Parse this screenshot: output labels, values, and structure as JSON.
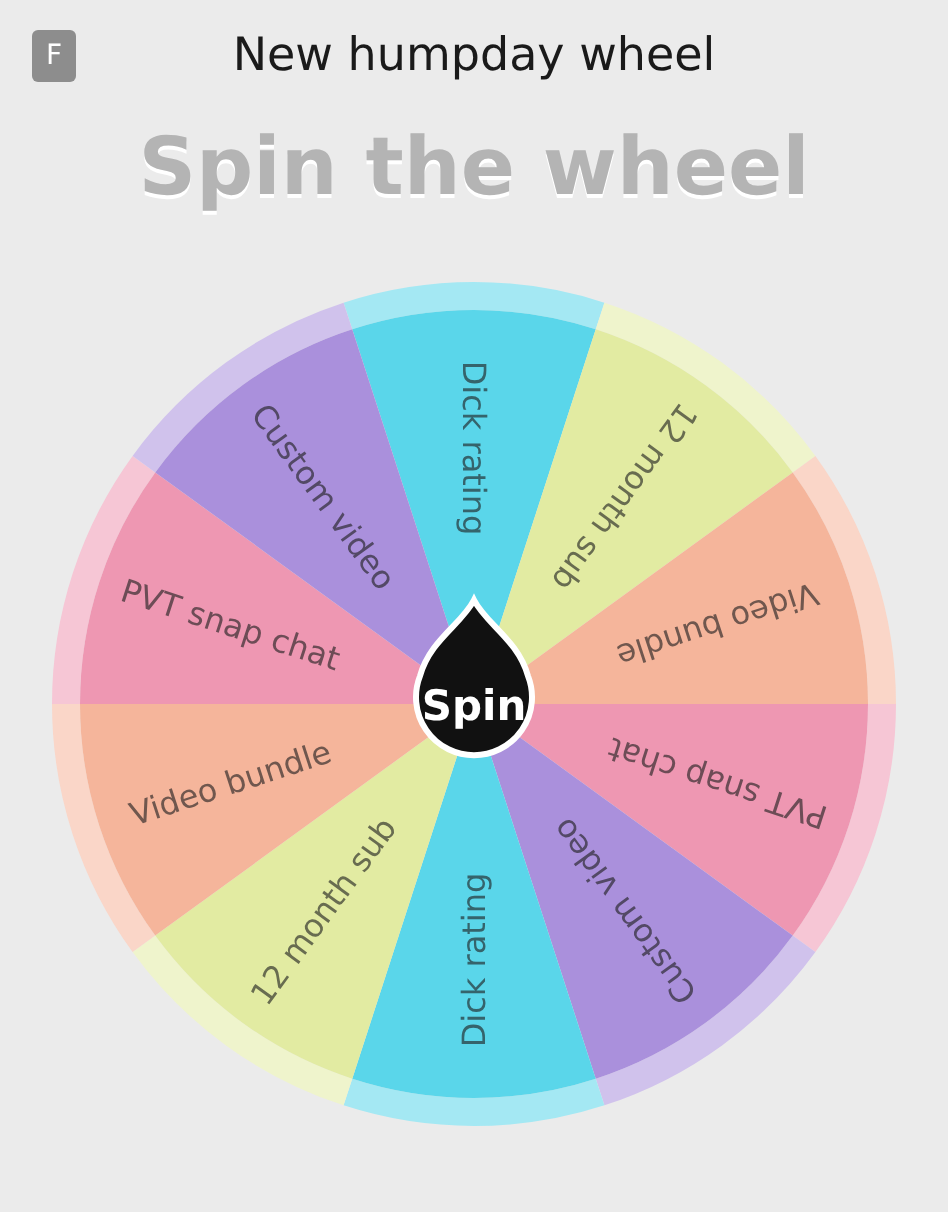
{
  "app_icon": {
    "letter": "F"
  },
  "title": "New humpday wheel",
  "heading": "Spin the wheel",
  "segments": [
    {
      "label": "Dick rating",
      "color": "#5ad6ea"
    },
    {
      "label": "12 month sub",
      "color": "#e2eba2"
    },
    {
      "label": "Video bundle",
      "color": "#f5b59b"
    },
    {
      "label": "PVT snap chat",
      "color": "#ee97b2"
    },
    {
      "label": "Custom video",
      "color": "#aa90dc"
    },
    {
      "label": "Dick rating",
      "color": "#5ad6ea"
    },
    {
      "label": "12 month sub",
      "color": "#e2eba2"
    },
    {
      "label": "Video bundle",
      "color": "#f5b59b"
    },
    {
      "label": "PVT snap chat",
      "color": "#ee97b2"
    },
    {
      "label": "Custom video",
      "color": "#aa90dc"
    }
  ],
  "spin_button": {
    "label": "Spin"
  }
}
